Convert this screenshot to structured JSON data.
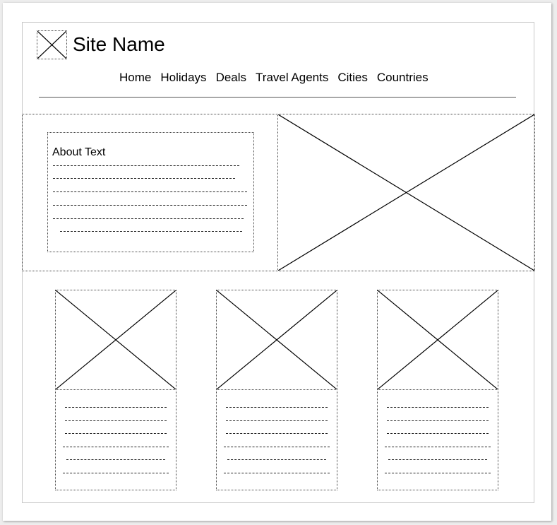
{
  "header": {
    "logo_icon": "image-placeholder-icon",
    "site_name": "Site Name",
    "nav": [
      "Home",
      "Holidays",
      "Deals",
      "Travel Agents",
      "Cities",
      "Countries"
    ]
  },
  "hero": {
    "about_title": "About Text",
    "about_text_icon": "placeholder-text-lines",
    "image_icon": "image-placeholder-icon"
  },
  "cards": [
    {
      "image_icon": "image-placeholder-icon",
      "text_icon": "placeholder-text-lines"
    },
    {
      "image_icon": "image-placeholder-icon",
      "text_icon": "placeholder-text-lines"
    },
    {
      "image_icon": "image-placeholder-icon",
      "text_icon": "placeholder-text-lines"
    }
  ]
}
